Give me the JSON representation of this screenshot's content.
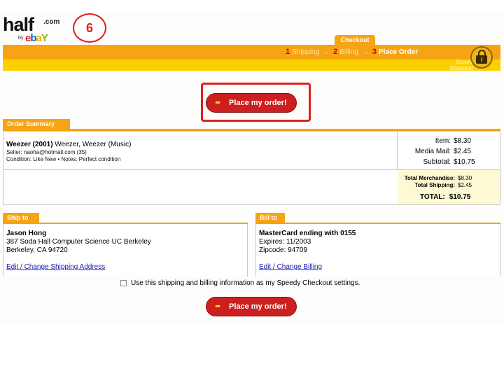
{
  "step_number": "6",
  "logo": {
    "brand": "half",
    "tld": ".com",
    "by": "by",
    "ebay": [
      "e",
      "b",
      "a",
      "Y"
    ]
  },
  "checkout": {
    "tab": "Checkout",
    "steps": [
      {
        "num": "1",
        "label": "Shipping",
        "arrow": "→"
      },
      {
        "num": "2",
        "label": "Billing",
        "arrow": "→"
      },
      {
        "num": "3",
        "label": "Place Order"
      }
    ],
    "secure_1": "Secure",
    "secure_2": "Shopping",
    "lock_glyph": "i"
  },
  "place_order_label": "Place my order!",
  "place_order_glyph": "•••",
  "order_summary": {
    "heading": "Order Summary",
    "item_title_bold": "Weezer (2001)",
    "item_title_rest": " Weezer, Weezer (Music)",
    "seller": "Seller: naoha@hotmail.com (35)",
    "condition": "Condition: Like New • Notes: Perfect condition",
    "item_label": "Item:",
    "item_value": "$8.30",
    "mail_label": "Media Mail:",
    "mail_value": "$2.45",
    "subtotal_label": "Subtotal:",
    "subtotal_value": "$10.75",
    "merch_label": "Total Merchandise:",
    "merch_value": "$8.30",
    "shipping_label": "Total Shipping:",
    "shipping_value": "$2.45",
    "total_label": "TOTAL:",
    "total_value": "$10.75"
  },
  "ship_to": {
    "heading": "Ship to",
    "name": "Jason Hong",
    "line1": "387 Soda Hall Computer Science UC Berkeley",
    "line2": "Berkeley, CA 94720",
    "link": "Edit / Change Shipping Address"
  },
  "bill_to": {
    "heading": "Bill to",
    "card": "MasterCard ending with 0155",
    "expires": "Expires: 11/2003",
    "zip": "Zipcode: 94709",
    "link": "Edit / Change Billing"
  },
  "speedy_label": "Use this shipping and billing information as my Speedy Checkout settings.",
  "colors": {
    "accent": "#f6a414",
    "bar_yellow": "#fcd000",
    "button_red": "#cc1f1f",
    "highlight_red": "#e02020",
    "link": "#1a1aa8"
  }
}
